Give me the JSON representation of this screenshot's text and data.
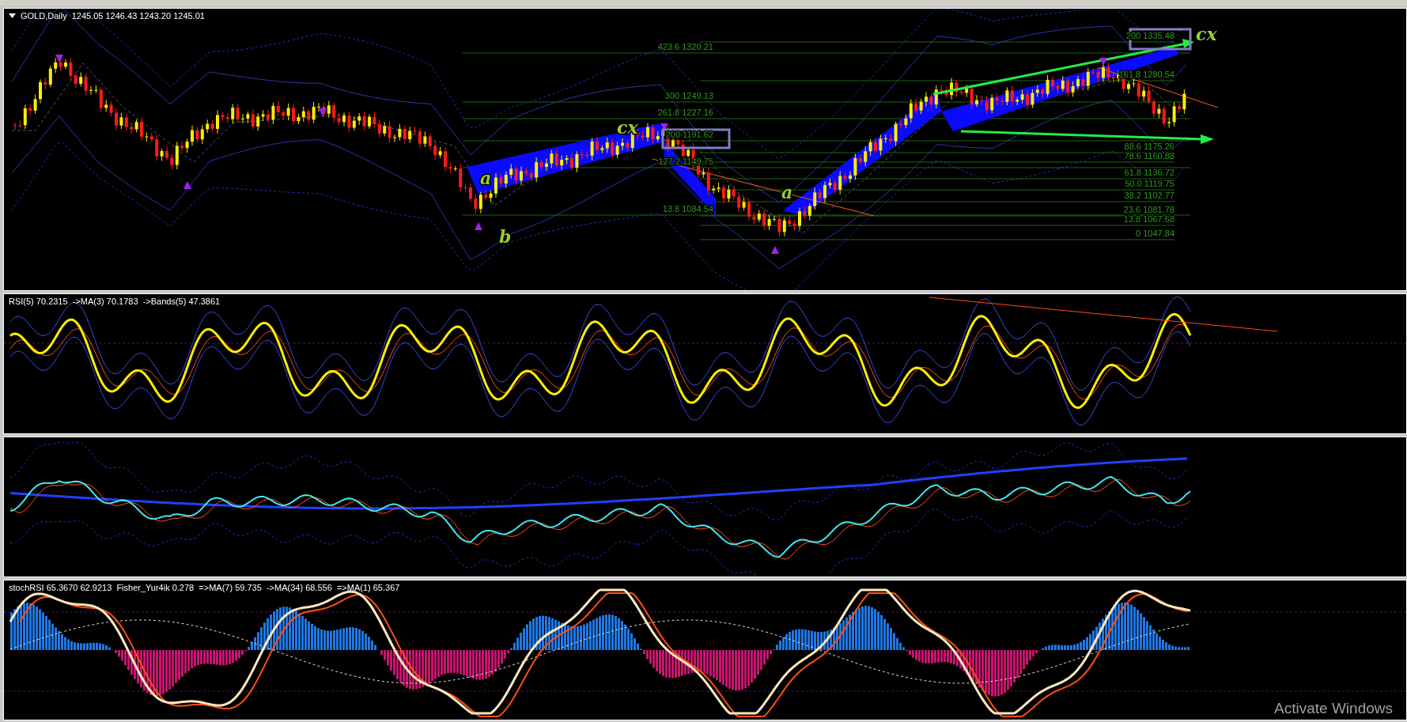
{
  "chart": {
    "title": "GOLD,Daily",
    "ohlc": "1245.05 1246.43 1243.20 1245.01",
    "fib_left": [
      "423.6 1320.21",
      "300 1249.13",
      "261.8 1227.16",
      "200 1191.62",
      "127.2 1149.75",
      "13.8 1084.54"
    ],
    "fib_right": [
      "200 1335.48",
      "161.8 1280.54",
      "88.6 1175.26",
      "78.6 1160.88",
      "61.8 1136.72",
      "50.0 1119.75",
      "38.2 1102.77",
      "23.6 1081.78",
      "13.8 1067.68",
      "0 1047.84"
    ],
    "wave_labels": [
      "cx",
      "cx",
      "a",
      "a",
      "b"
    ]
  },
  "panels": [
    {
      "kind": "rsi",
      "header": "RSI(5) 70.2315  ->MA(3) 70.1783  ->Bands(5) 47.3861"
    },
    {
      "kind": "bands"
    },
    {
      "kind": "stoch",
      "header": "stochRSI 65.3670 62.9213  Fisher_Yur4ik 0.278  =>MA(7) 59.735  ->MA(34) 68.556  =>MA(1) 65.367"
    }
  ],
  "system_notice": "Activate Windows"
}
